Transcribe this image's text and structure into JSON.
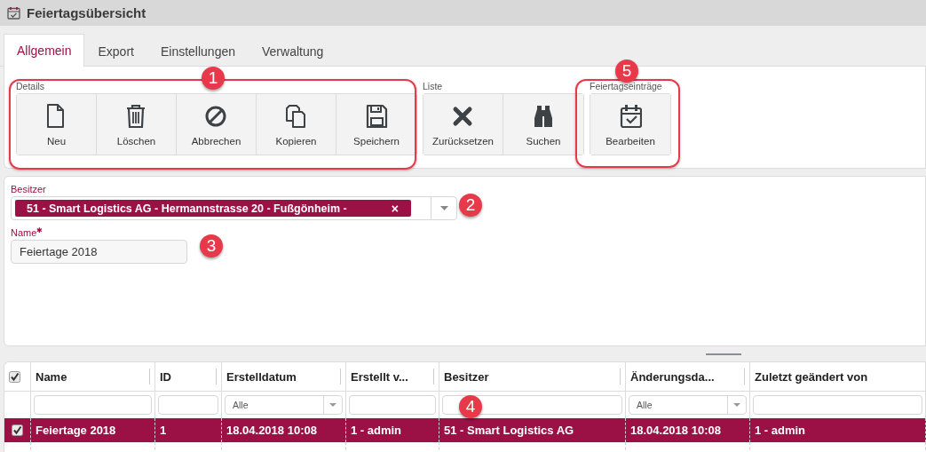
{
  "window": {
    "title": "Feiertagsübersicht"
  },
  "tabs": [
    {
      "label": "Allgemein",
      "selected": true
    },
    {
      "label": "Export",
      "selected": false
    },
    {
      "label": "Einstellungen",
      "selected": false
    },
    {
      "label": "Verwaltung",
      "selected": false
    }
  ],
  "toolbar": {
    "groups": [
      {
        "label": "Details",
        "buttons": [
          {
            "kind": "new",
            "label": "Neu"
          },
          {
            "kind": "delete",
            "label": "Löschen"
          },
          {
            "kind": "cancel",
            "label": "Abbrechen"
          },
          {
            "kind": "copy",
            "label": "Kopieren"
          },
          {
            "kind": "save",
            "label": "Speichern"
          }
        ]
      },
      {
        "label": "Liste",
        "buttons": [
          {
            "kind": "reset",
            "label": "Zurücksetzen"
          },
          {
            "kind": "search",
            "label": "Suchen"
          }
        ]
      },
      {
        "label": "Feiertagseinträge",
        "buttons": [
          {
            "kind": "edit",
            "label": "Bearbeiten"
          }
        ]
      }
    ]
  },
  "form": {
    "owner": {
      "label": "Besitzer",
      "chip": "51 - Smart Logistics AG - Hermannstrasse 20 - Fußgönheim -",
      "chip_remove": "×"
    },
    "name": {
      "label": "Name",
      "required_mark": "✱",
      "value": "Feiertage 2018"
    }
  },
  "grid": {
    "header_checked": true,
    "columns": [
      {
        "label": "Name",
        "filter": {
          "kind": "text"
        }
      },
      {
        "label": "ID",
        "filter": {
          "kind": "text"
        }
      },
      {
        "label": "Erstelldatum",
        "filter": {
          "kind": "select",
          "value": "Alle"
        }
      },
      {
        "label": "Erstellt v...",
        "filter": {
          "kind": "text"
        }
      },
      {
        "label": "Besitzer",
        "filter": {
          "kind": "text"
        }
      },
      {
        "label": "Änderungsda...",
        "filter": {
          "kind": "select",
          "value": "Alle"
        }
      },
      {
        "label": "Zuletzt geändert von",
        "filter": {
          "kind": "text"
        }
      }
    ],
    "rows": [
      {
        "selected": true,
        "checked": true,
        "cells": [
          "Feiertage 2018",
          "1",
          "18.04.2018 10:08",
          "1 - admin",
          "51 - Smart Logistics AG",
          "18.04.2018 10:08",
          "1 - admin"
        ]
      }
    ]
  },
  "callouts": [
    {
      "number": "1",
      "framed": true
    },
    {
      "number": "2",
      "framed": false
    },
    {
      "number": "3",
      "framed": false
    },
    {
      "number": "4",
      "framed": false
    },
    {
      "number": "5",
      "framed": true
    }
  ]
}
